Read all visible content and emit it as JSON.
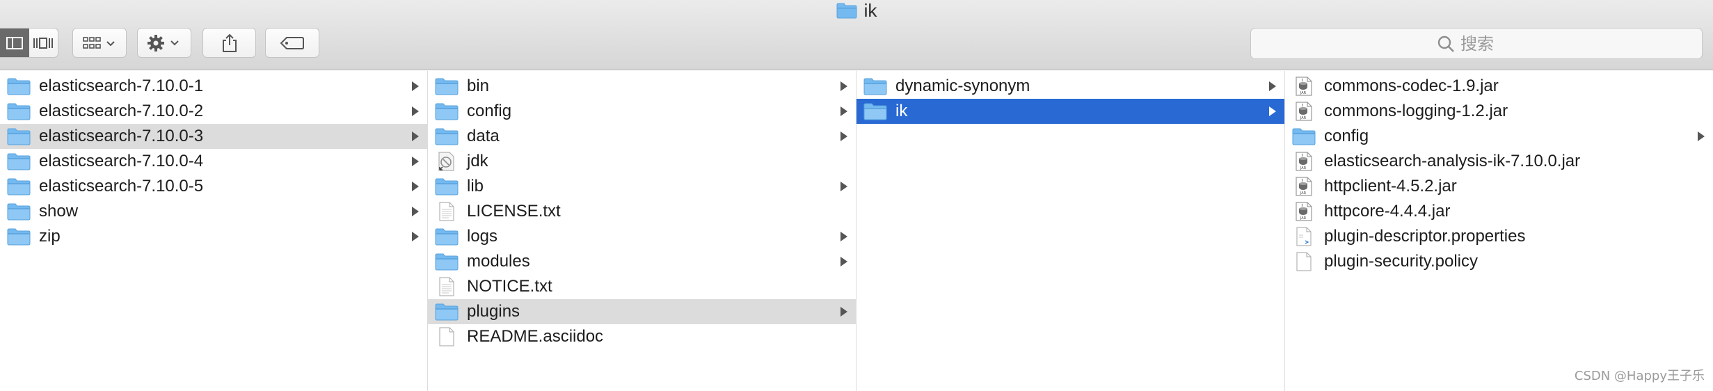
{
  "window": {
    "title": "ik",
    "title_icon": "folder-icon"
  },
  "toolbar": {
    "view_buttons": [
      "columns-view-icon",
      "gallery-view-icon"
    ],
    "group_icon": "group-by-icon",
    "action_icon": "gear-icon",
    "share_icon": "share-icon",
    "tag_icon": "tag-icon",
    "search_placeholder": "搜索"
  },
  "colors": {
    "selection_blue": "#2869d4",
    "selection_gray": "#dcdcdc",
    "folder": "#74b9ef"
  },
  "columns": [
    {
      "items": [
        {
          "label": "elasticsearch-7.10.0-1",
          "icon": "folder-icon",
          "arrow": true
        },
        {
          "label": "elasticsearch-7.10.0-2",
          "icon": "folder-icon",
          "arrow": true
        },
        {
          "label": "elasticsearch-7.10.0-3",
          "icon": "folder-icon",
          "arrow": true,
          "selected": "gray"
        },
        {
          "label": "elasticsearch-7.10.0-4",
          "icon": "folder-icon",
          "arrow": true
        },
        {
          "label": "elasticsearch-7.10.0-5",
          "icon": "folder-icon",
          "arrow": true
        },
        {
          "label": "show",
          "icon": "folder-icon",
          "arrow": true
        },
        {
          "label": "zip",
          "icon": "folder-icon",
          "arrow": true
        }
      ]
    },
    {
      "items": [
        {
          "label": "bin",
          "icon": "folder-icon",
          "arrow": true
        },
        {
          "label": "config",
          "icon": "folder-icon",
          "arrow": true
        },
        {
          "label": "data",
          "icon": "folder-icon",
          "arrow": true
        },
        {
          "label": "jdk",
          "icon": "jdk-alias-icon",
          "arrow": false
        },
        {
          "label": "lib",
          "icon": "folder-icon",
          "arrow": true
        },
        {
          "label": "LICENSE.txt",
          "icon": "text-file-icon",
          "arrow": false
        },
        {
          "label": "logs",
          "icon": "folder-icon",
          "arrow": true
        },
        {
          "label": "modules",
          "icon": "folder-icon",
          "arrow": true
        },
        {
          "label": "NOTICE.txt",
          "icon": "text-file-icon",
          "arrow": false
        },
        {
          "label": "plugins",
          "icon": "folder-icon",
          "arrow": true,
          "selected": "gray"
        },
        {
          "label": "README.asciidoc",
          "icon": "blank-file-icon",
          "arrow": false
        }
      ]
    },
    {
      "items": [
        {
          "label": "dynamic-synonym",
          "icon": "folder-icon",
          "arrow": true
        },
        {
          "label": "ik",
          "icon": "folder-icon",
          "arrow": true,
          "selected": "blue"
        }
      ]
    },
    {
      "items": [
        {
          "label": "commons-codec-1.9.jar",
          "icon": "jar-file-icon",
          "arrow": false
        },
        {
          "label": "commons-logging-1.2.jar",
          "icon": "jar-file-icon",
          "arrow": false
        },
        {
          "label": "config",
          "icon": "folder-icon",
          "arrow": true
        },
        {
          "label": "elasticsearch-analysis-ik-7.10.0.jar",
          "icon": "jar-file-icon",
          "arrow": false
        },
        {
          "label": "httpclient-4.5.2.jar",
          "icon": "jar-file-icon",
          "arrow": false
        },
        {
          "label": "httpcore-4.4.4.jar",
          "icon": "jar-file-icon",
          "arrow": false
        },
        {
          "label": "plugin-descriptor.properties",
          "icon": "properties-file-icon",
          "arrow": false
        },
        {
          "label": "plugin-security.policy",
          "icon": "blank-file-icon",
          "arrow": false
        }
      ]
    }
  ],
  "watermark": "CSDN @Happy王子乐"
}
